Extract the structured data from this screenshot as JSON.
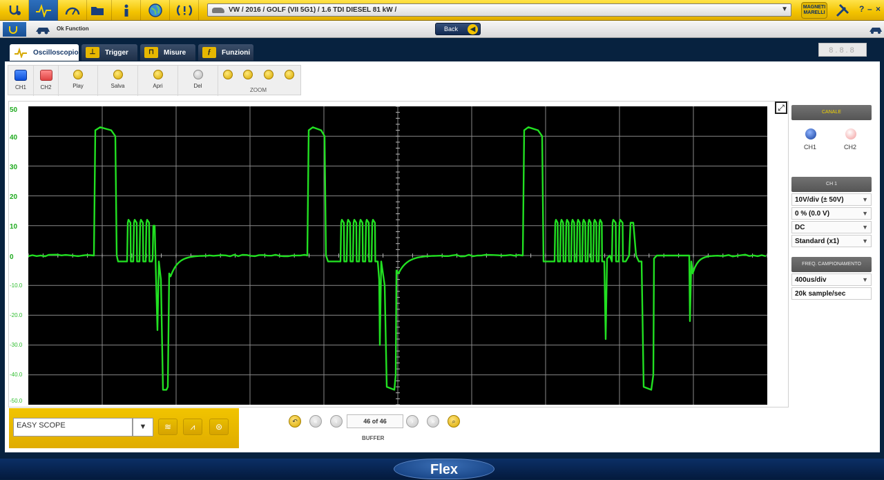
{
  "topbar": {
    "vehicle": "VW / 2016 / GOLF (VII 5G1) / 1.6 TDI DIESEL 81 kW /",
    "brand": "MAGNETI MARELLI",
    "icons": [
      "stethoscope-icon",
      "oscilloscope-icon",
      "gauge-icon",
      "folder-icon",
      "info-icon",
      "globe-icon",
      "tpms-icon"
    ]
  },
  "subbar": {
    "ok_function": "Ok Function",
    "back_label": "Back",
    "digits": "8.8.8"
  },
  "tabs": [
    {
      "label": "Oscilloscopio",
      "active": true
    },
    {
      "label": "Trigger"
    },
    {
      "label": "Misure"
    },
    {
      "label": "Funzioni"
    }
  ],
  "toolbar": {
    "ch1": "CH1",
    "ch2": "CH2",
    "play": "Play",
    "salva": "Salva",
    "apri": "Apri",
    "del": "Del",
    "zoom": "ZOOM"
  },
  "scope": {
    "y_labels": [
      "50",
      "40",
      "30",
      "20",
      "10",
      "0",
      "-10.0",
      "-20.0",
      "-30.0",
      "-40.0",
      "-50.0"
    ],
    "trace_color": "#22e022"
  },
  "right_panel": {
    "canale": "CANALE",
    "ch1": "CH1",
    "ch2": "CH2",
    "ch_header": "CH 1",
    "volt_div": "10V/div (± 50V)",
    "offset": "0 % (0.0 V)",
    "coupling": "DC",
    "probe": "Standard (x1)",
    "freq_header": "FREQ. CAMPIONAMENTO",
    "time_div": "400us/div",
    "sample_rate": "20k sample/sec"
  },
  "bottom": {
    "easy_scope": "EASY SCOPE",
    "buffer_position": "46 of 46",
    "buffer_label": "BUFFER"
  },
  "footer": {
    "logo": "Flex"
  }
}
